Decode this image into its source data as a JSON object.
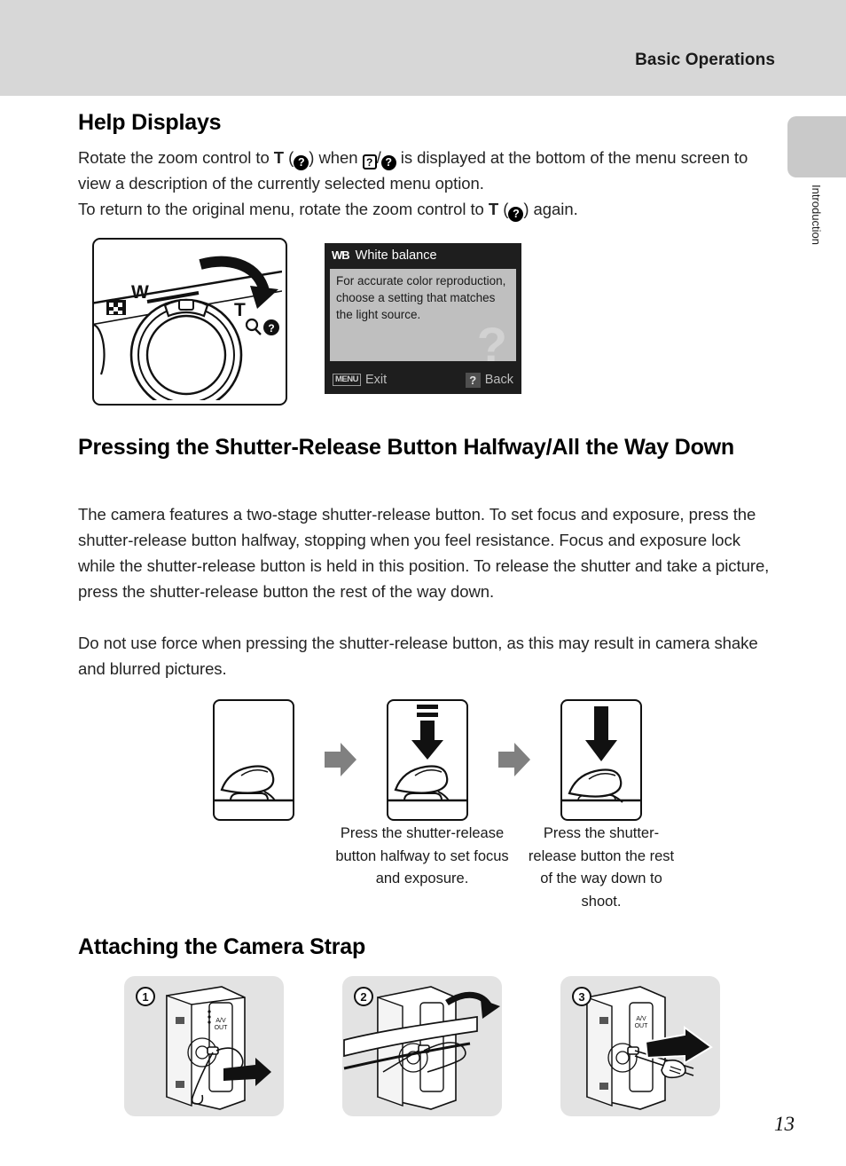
{
  "header": {
    "title": "Basic Operations"
  },
  "side_tab": {
    "label": "Introduction"
  },
  "sections": {
    "help_displays": {
      "heading": "Help Displays",
      "para_line1_a": "Rotate the zoom control to ",
      "para_T1": "T",
      "para_line1_b": " (",
      "icon_q_round_1": "?",
      "para_line1_c": ") when ",
      "icon_q_box": "?",
      "para_line1_d": "/",
      "icon_q_round_2": "?",
      "para_line1_e": " is displayed at the bottom of the menu screen to view a description of the currently selected menu option.",
      "para_line2_a": "To return to the original menu, rotate the zoom control to ",
      "para_T2": "T",
      "para_line2_b": " (",
      "icon_q_round_3": "?",
      "para_line2_c": ") again.",
      "zoom_figure": {
        "label_w": "W",
        "label_t": "T",
        "icon_thumbnail": "thumbnail-icon",
        "icon_magnifier": "magnifier-icon",
        "icon_help": "?"
      },
      "lcd": {
        "mode_icon": "WB",
        "title": "White balance",
        "body": "For accurate color reproduction, choose a setting that matches the light source.",
        "watermark": "?",
        "footer_menu_label": "MENU",
        "footer_exit": "Exit",
        "footer_back_icon": "?",
        "footer_back": "Back"
      }
    },
    "shutter": {
      "heading": "Pressing the Shutter-Release Button Halfway/All the Way Down",
      "para1": "The camera features a two-stage shutter-release button. To set focus and exposure, press the shutter-release button halfway, stopping when you feel resistance. Focus and exposure lock while the shutter-release button is held in this position. To release the shutter and take a picture, press the shutter-release button the rest of the way down.",
      "para2": "Do not use force when pressing the shutter-release button, as this may result in camera shake and blurred pictures.",
      "caption_halfway": "Press the shutter-release button halfway to set focus and exposure.",
      "caption_full": "Press the shutter-release button the rest of the way down to shoot."
    },
    "strap": {
      "heading": "Attaching the Camera Strap",
      "steps": [
        {
          "number": "1"
        },
        {
          "number": "2"
        },
        {
          "number": "3"
        }
      ]
    }
  },
  "page_number": "13",
  "colors": {
    "header_band": "#d7d7d7",
    "side_tab": "#c9c9c9",
    "lcd_background": "#1e1e1e",
    "lcd_content": "#bfbfbf",
    "strap_panel": "#e3e3e3",
    "arrow_gray": "#808080"
  }
}
